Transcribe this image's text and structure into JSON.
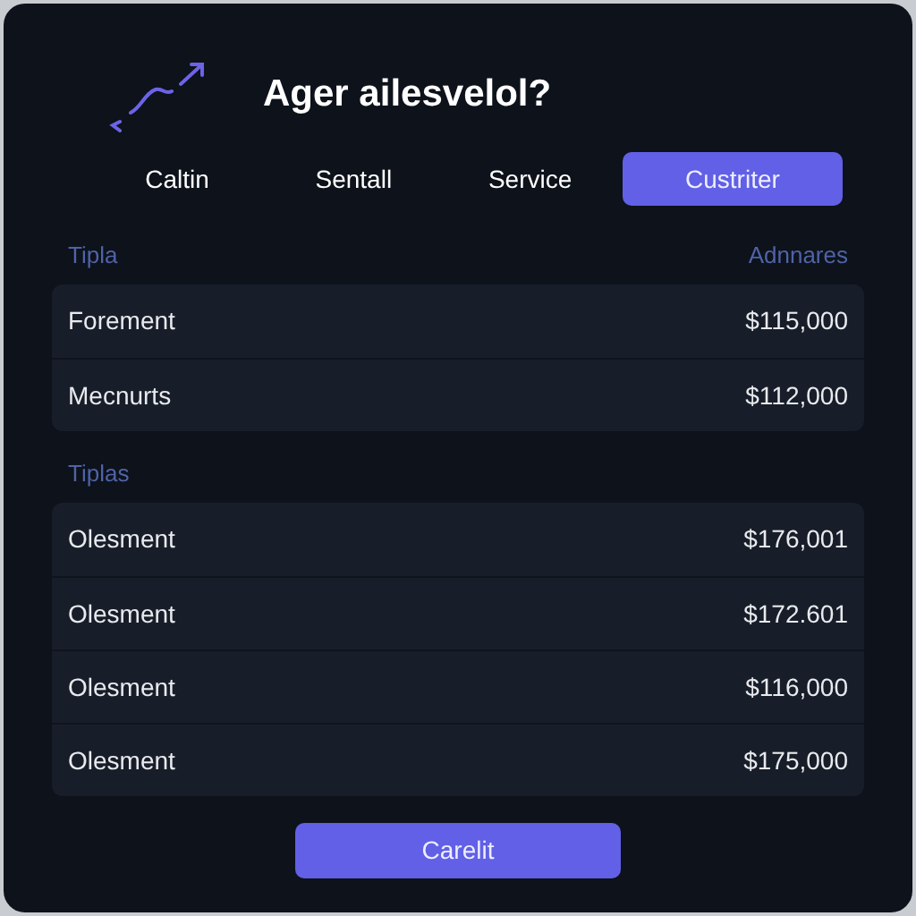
{
  "title": "Ager ailesvelol?",
  "tabs": [
    {
      "label": "Caltin",
      "selected": false
    },
    {
      "label": "Sentall",
      "selected": false
    },
    {
      "label": "Service",
      "selected": false
    },
    {
      "label": "Custriter",
      "selected": true
    }
  ],
  "sections": [
    {
      "header": "Tipla",
      "header_right": "Adnnares",
      "rows": [
        {
          "name": "Forement",
          "amount": "$115,000"
        },
        {
          "name": "Mecnurts",
          "amount": "$112,000"
        }
      ]
    },
    {
      "header": "Tiplas",
      "rows": [
        {
          "name": "Olesment",
          "amount": "$176,001"
        },
        {
          "name": "Olesment",
          "amount": "$172.601"
        },
        {
          "name": "Olesment",
          "amount": "$116,000"
        },
        {
          "name": "Olesment",
          "amount": "$175,000"
        }
      ]
    }
  ],
  "button": "Carelit"
}
